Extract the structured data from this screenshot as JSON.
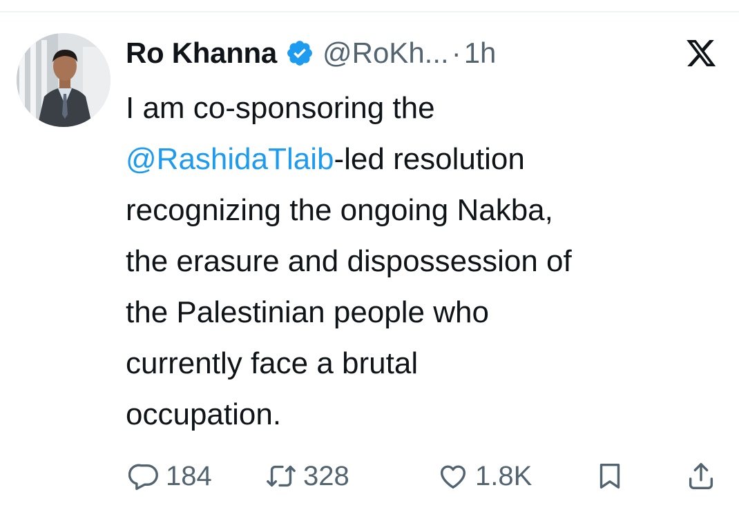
{
  "tweet": {
    "author": {
      "display_name": "Ro Khanna",
      "handle": "@RoKh...",
      "verified": true
    },
    "separator": "·",
    "time": "1h",
    "text_lines": [
      {
        "before": "I am co-sponsoring the",
        "mention": "",
        "after": ""
      },
      {
        "before": "",
        "mention": "@RashidaTlaib",
        "after": "-led resolution"
      },
      {
        "before": "recognizing the ongoing Nakba,",
        "mention": "",
        "after": ""
      },
      {
        "before": "the erasure and dispossession of",
        "mention": "",
        "after": ""
      },
      {
        "before": "the Palestinian people who",
        "mention": "",
        "after": ""
      },
      {
        "before": "currently face a brutal",
        "mention": "",
        "after": ""
      },
      {
        "before": "occupation.",
        "mention": "",
        "after": ""
      }
    ],
    "metrics": {
      "replies": "184",
      "reposts": "328",
      "likes": "1.8K"
    }
  },
  "icons": {
    "verified": "verified-badge-icon",
    "platform": "x-logo-icon",
    "reply": "reply-icon",
    "repost": "repost-icon",
    "like": "heart-icon",
    "bookmark": "bookmark-icon",
    "share": "share-icon"
  },
  "colors": {
    "text": "#0f1419",
    "secondary": "#536471",
    "accent": "#1d9bf0"
  }
}
